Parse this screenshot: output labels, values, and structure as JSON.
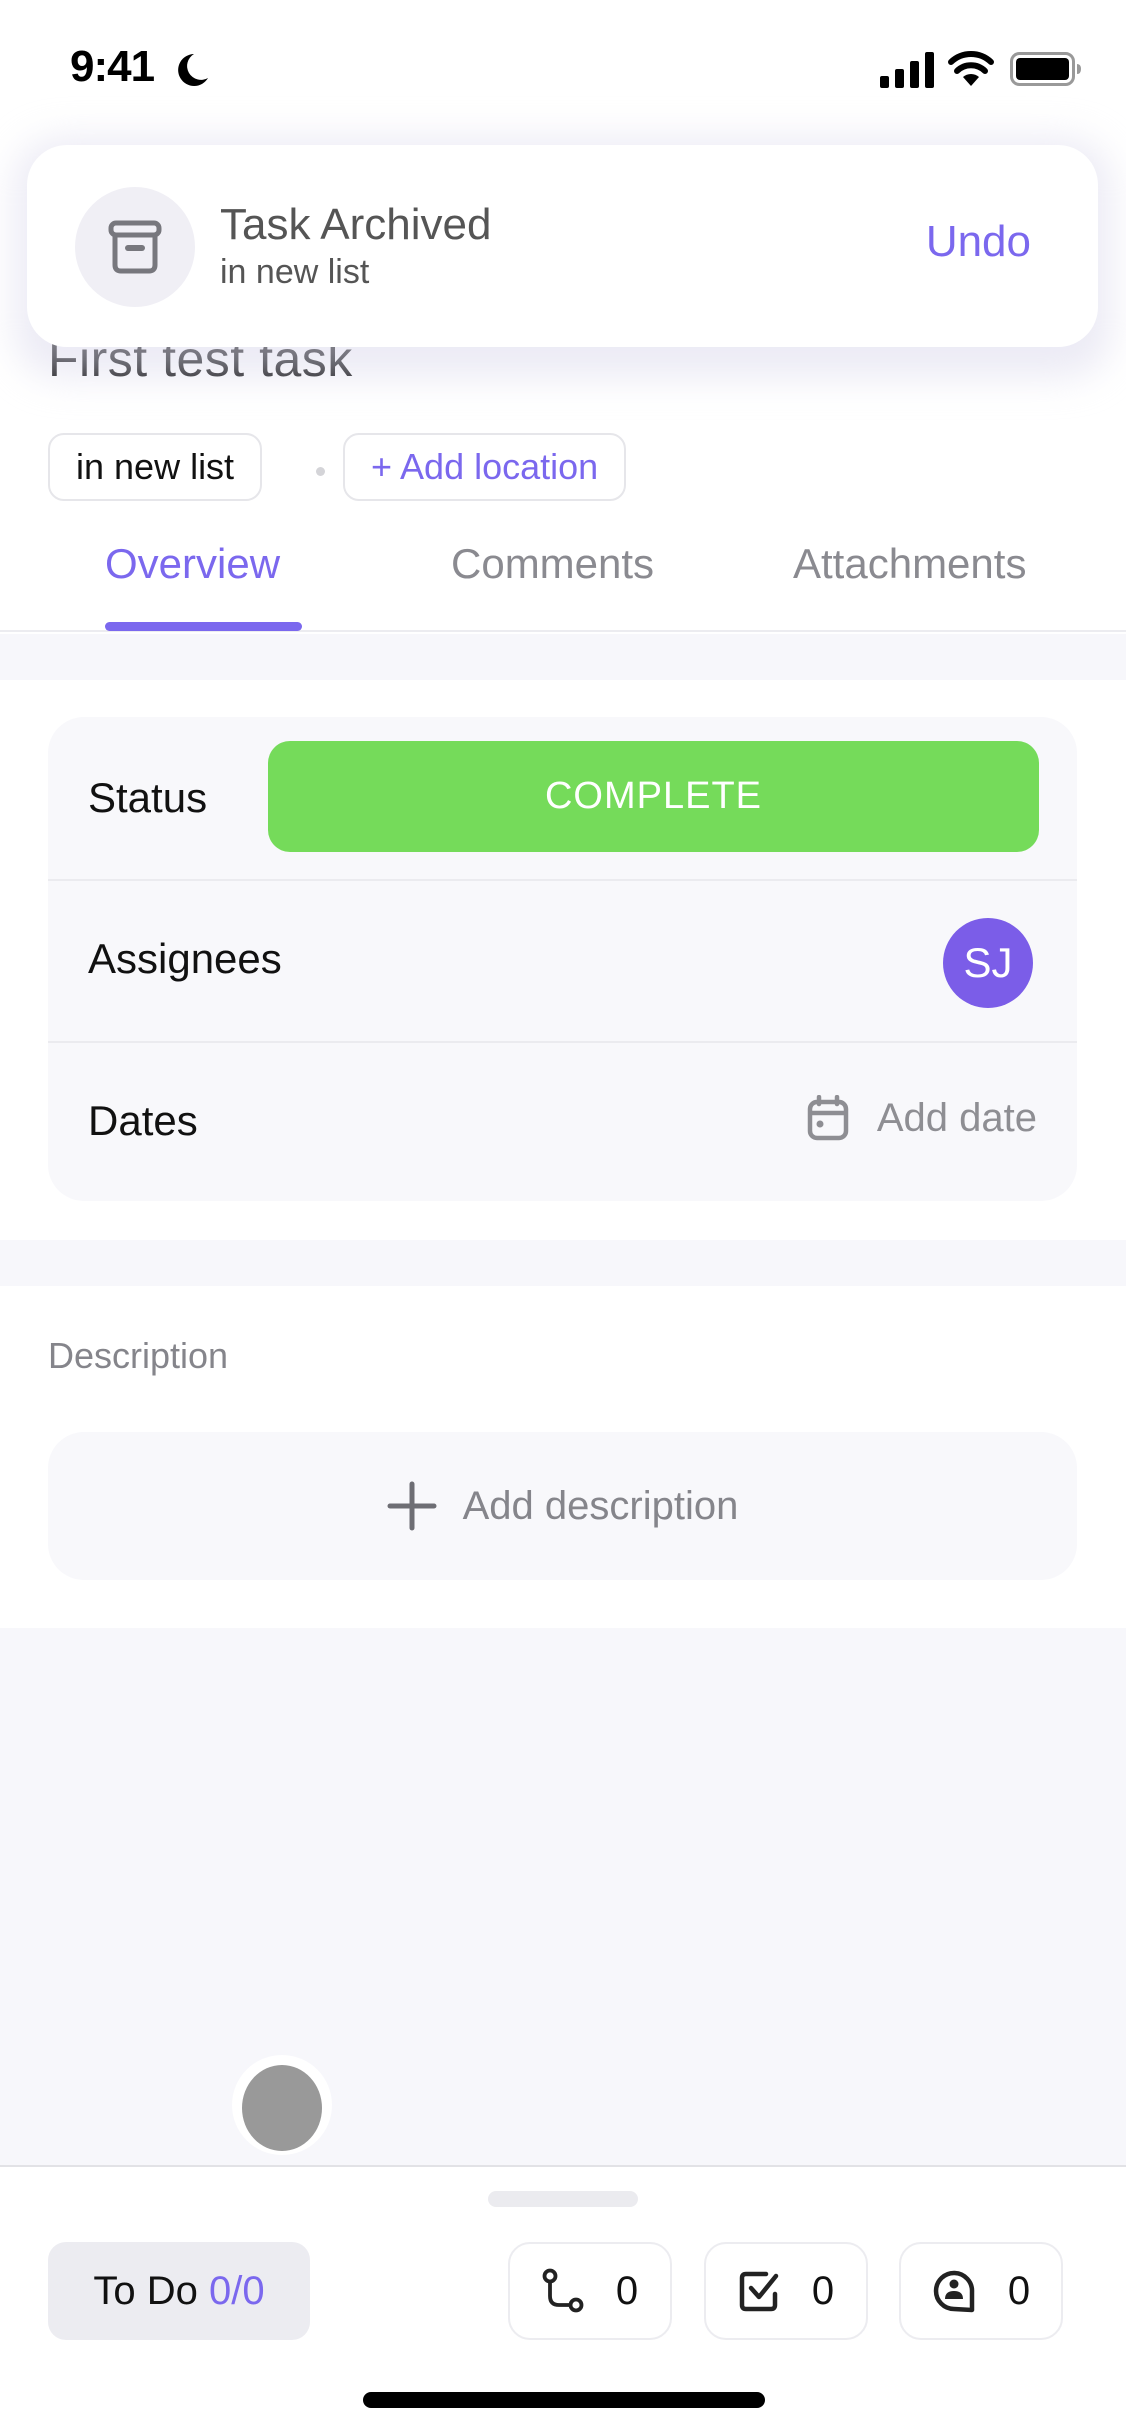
{
  "status_bar": {
    "time": "9:41",
    "icons": [
      "moon-icon",
      "cellular-signal-icon",
      "wifi-icon",
      "battery-icon"
    ]
  },
  "task": {
    "title": "First test task",
    "list_chip": "in new list",
    "add_location": "+ Add location"
  },
  "tabs": [
    {
      "label": "Overview",
      "active": true
    },
    {
      "label": "Comments",
      "active": false
    },
    {
      "label": "Attachments",
      "active": false
    }
  ],
  "fields": {
    "status": {
      "label": "Status",
      "value": "COMPLETE",
      "color": "#75db5a"
    },
    "assignees": {
      "label": "Assignees",
      "avatar_initials": "SJ",
      "avatar_color": "#7b5de8"
    },
    "dates": {
      "label": "Dates",
      "action": "Add date",
      "icon": "calendar-icon"
    }
  },
  "description": {
    "label": "Description",
    "action": "Add description",
    "icon": "plus-icon"
  },
  "bottom_bar": {
    "todo_label": "To Do",
    "todo_count": "0/0",
    "counters": [
      {
        "icon": "subtask-route-icon",
        "value": "0"
      },
      {
        "icon": "checklist-icon",
        "value": "0"
      },
      {
        "icon": "assigned-comment-icon",
        "value": "0"
      }
    ]
  },
  "toast": {
    "icon": "archive-box-icon",
    "title": "Task Archived",
    "subtitle": "in new list",
    "action": "Undo"
  },
  "colors": {
    "accent": "#7b68ee",
    "status_complete": "#75db5a",
    "background_gray": "#f7f7fb"
  }
}
